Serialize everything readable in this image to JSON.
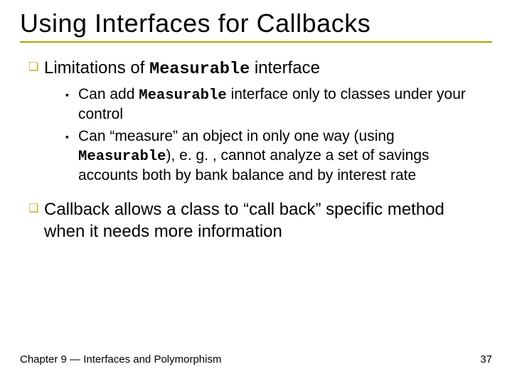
{
  "title": "Using Interfaces for Callbacks",
  "bullets": {
    "b1": {
      "pre": "Limitations of ",
      "code": "Measurable",
      "post": " interface"
    },
    "b1a": {
      "pre": "Can add ",
      "code": "Measurable",
      "post": " interface only to classes under your control"
    },
    "b1b": {
      "pre": "Can “measure” an object in only one way (using ",
      "code": "Measurable",
      "post": "), e. g. , cannot analyze a set of savings accounts both by bank balance and by interest rate"
    },
    "b2": "Callback allows a class to “call back” specific method when it needs more information"
  },
  "footer": {
    "left": "Chapter 9 — Interfaces and Polymorphism",
    "right": "37"
  },
  "markers": {
    "l1": "❏",
    "l2": "▪"
  }
}
